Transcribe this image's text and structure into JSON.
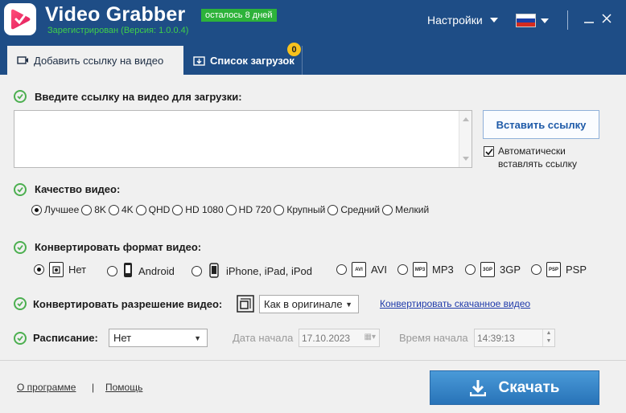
{
  "header": {
    "app_title": "Video Grabber",
    "trial_badge": "осталось 8 дней",
    "registration": "Зарегистрирован (Версия: 1.0.0.4)",
    "settings": "Настройки",
    "language_flag": "ru-flag",
    "colors": {
      "header_bg": "#1e4d86",
      "trial_green": "#2db23a",
      "accent": "#1e5aa8"
    }
  },
  "tabs": [
    {
      "label": "Добавить ссылку на видео",
      "active": true,
      "icon": "video-add-icon"
    },
    {
      "label": "Список загрузок",
      "active": false,
      "icon": "download-list-icon",
      "count": "0"
    }
  ],
  "url_section": {
    "label": "Введите ссылку на видео для загрузки:",
    "value": "",
    "paste_button": "Вставить ссылку",
    "auto_paste_line1": "Автоматически",
    "auto_paste_line2": "вставлять ссылку",
    "auto_paste_checked": true
  },
  "quality": {
    "label": "Качество видео:",
    "options": [
      "Лучшее",
      "8K",
      "4K",
      "QHD",
      "HD 1080",
      "HD 720",
      "Крупный",
      "Средний",
      "Мелкий"
    ],
    "selected": "Лучшее"
  },
  "format": {
    "label": "Конвертировать формат видео:",
    "options": [
      {
        "label": "Нет",
        "icon": "no-convert-icon"
      },
      {
        "label": "Android",
        "icon": "android-phone-icon"
      },
      {
        "label": "iPhone, iPad, iPod",
        "icon": "iphone-icon"
      },
      {
        "label": "AVI",
        "icon": "avi-file-icon",
        "tag": "AVI"
      },
      {
        "label": "MP3",
        "icon": "mp3-file-icon",
        "tag": "MP3"
      },
      {
        "label": "3GP",
        "icon": "3gp-file-icon",
        "tag": "3GP"
      },
      {
        "label": "PSP",
        "icon": "psp-file-icon",
        "tag": "PSP"
      }
    ],
    "selected": "Нет"
  },
  "resolution": {
    "label": "Конвертировать разрешение видео:",
    "value": "Как в оригинале",
    "convert_link": "Конвертировать скачанное видео"
  },
  "schedule": {
    "label": "Расписание:",
    "value": "Нет",
    "start_date_label": "Дата начала",
    "start_date": "17.10.2023",
    "start_time_label": "Время начала",
    "start_time": "14:39:13"
  },
  "footer": {
    "about": "О программе",
    "separator": "|",
    "help": "Помощь",
    "download": "Скачать"
  }
}
